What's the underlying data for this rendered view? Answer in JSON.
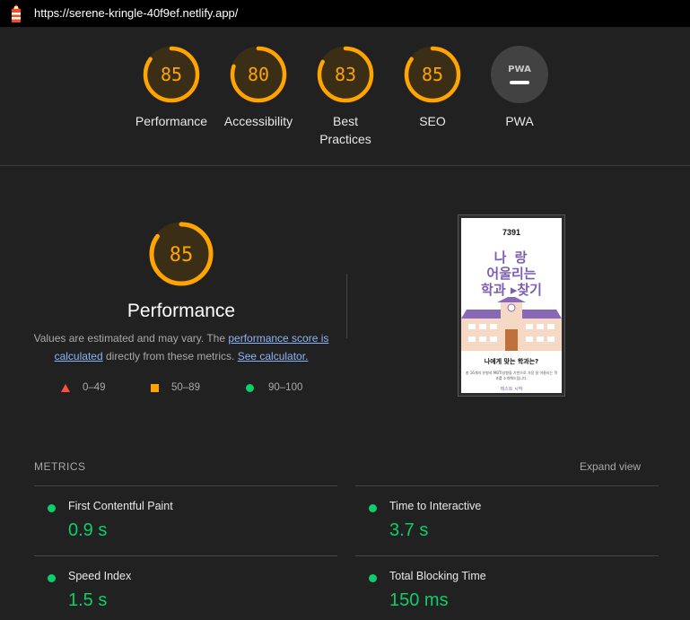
{
  "browser": {
    "url": "https://serene-kringle-40f9ef.netlify.app/",
    "favicon_icon": "lighthouse-icon"
  },
  "colors": {
    "average": "#ffa400",
    "pass": "#0cce6b",
    "fail": "#ff4e42",
    "link": "#8ab4f8"
  },
  "gauges": [
    {
      "score": "85",
      "value": 85,
      "label": "Performance"
    },
    {
      "score": "80",
      "value": 80,
      "label": "Accessibility"
    },
    {
      "score": "83",
      "value": 83,
      "label": "Best Practices"
    },
    {
      "score": "85",
      "value": 85,
      "label": "SEO"
    },
    {
      "score": "PWA",
      "label": "PWA",
      "icon": "pwa-badge-icon"
    }
  ],
  "performance": {
    "score": "85",
    "value": 85,
    "title": "Performance",
    "desc_prefix": "Values are estimated and may vary. The ",
    "score_link": "performance score is calculated",
    "desc_mid": " directly from these metrics. ",
    "calc_link": "See calculator."
  },
  "legend": {
    "fail": "0–49",
    "average": "50–89",
    "pass": "90–100"
  },
  "screenshot": {
    "number": "7391",
    "line1": "나 랑",
    "line2": "어울리는",
    "line3": "학과 ▸찾기",
    "question": "나에게 맞는 학과는?",
    "small_text": "총 16개의 유형의 MBTI성향을 기반으로 가장 잘 어울리는 학과를 소개해드립니다.",
    "start": "테스트 시작"
  },
  "metrics": {
    "header": "METRICS",
    "expand": "Expand view",
    "items": [
      {
        "name": "First Contentful Paint",
        "value": "0.9 s"
      },
      {
        "name": "Time to Interactive",
        "value": "3.7 s"
      },
      {
        "name": "Speed Index",
        "value": "1.5 s"
      },
      {
        "name": "Total Blocking Time",
        "value": "150 ms"
      }
    ]
  }
}
